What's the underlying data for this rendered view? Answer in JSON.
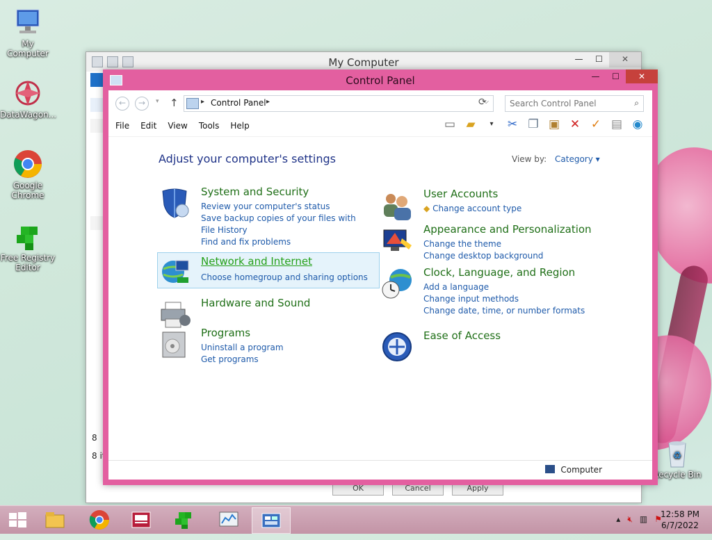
{
  "desktop": {
    "icons": [
      {
        "label": "My Computer"
      },
      {
        "label": "DataWagon..."
      },
      {
        "label": "Google Chrome"
      },
      {
        "label": "Free Registry Editor"
      },
      {
        "label": "Recycle Bin"
      }
    ]
  },
  "bg_window": {
    "title": "My Computer",
    "footer_item_count": "8 it",
    "footer_partial": "8",
    "dialog_buttons": [
      "OK",
      "Cancel",
      "Apply"
    ]
  },
  "control_panel": {
    "title": "Control Panel",
    "address": {
      "crumb": "Control Panel"
    },
    "search": {
      "placeholder": "Search Control Panel"
    },
    "menu": [
      "File",
      "Edit",
      "View",
      "Tools",
      "Help"
    ],
    "heading": "Adjust your computer's settings",
    "view_by": {
      "label": "View by:",
      "value": "Category"
    },
    "categories_left": [
      {
        "title": "System and Security",
        "links": [
          "Review your computer's status",
          "Save backup copies of your files with File History",
          "Find and fix problems"
        ]
      },
      {
        "title": "Network and Internet",
        "links": [
          "Choose homegroup and sharing options"
        ]
      },
      {
        "title": "Hardware and Sound",
        "links": []
      },
      {
        "title": "Programs",
        "links": [
          "Uninstall a program",
          "Get programs"
        ]
      }
    ],
    "categories_right": [
      {
        "title": "User Accounts",
        "links": [
          "Change account type"
        ]
      },
      {
        "title": "Appearance and Personalization",
        "links": [
          "Change the theme",
          "Change desktop background"
        ]
      },
      {
        "title": "Clock, Language, and Region",
        "links": [
          "Add a language",
          "Change input methods",
          "Change date, time, or number formats"
        ]
      },
      {
        "title": "Ease of Access",
        "links": []
      }
    ],
    "status": {
      "location": "Computer"
    }
  },
  "taskbar": {
    "time": "12:58 PM",
    "date": "6/7/2022"
  },
  "colors": {
    "accent_frame": "#e35fa0",
    "link": "#1e5aaa",
    "category_title": "#1f6f17"
  }
}
